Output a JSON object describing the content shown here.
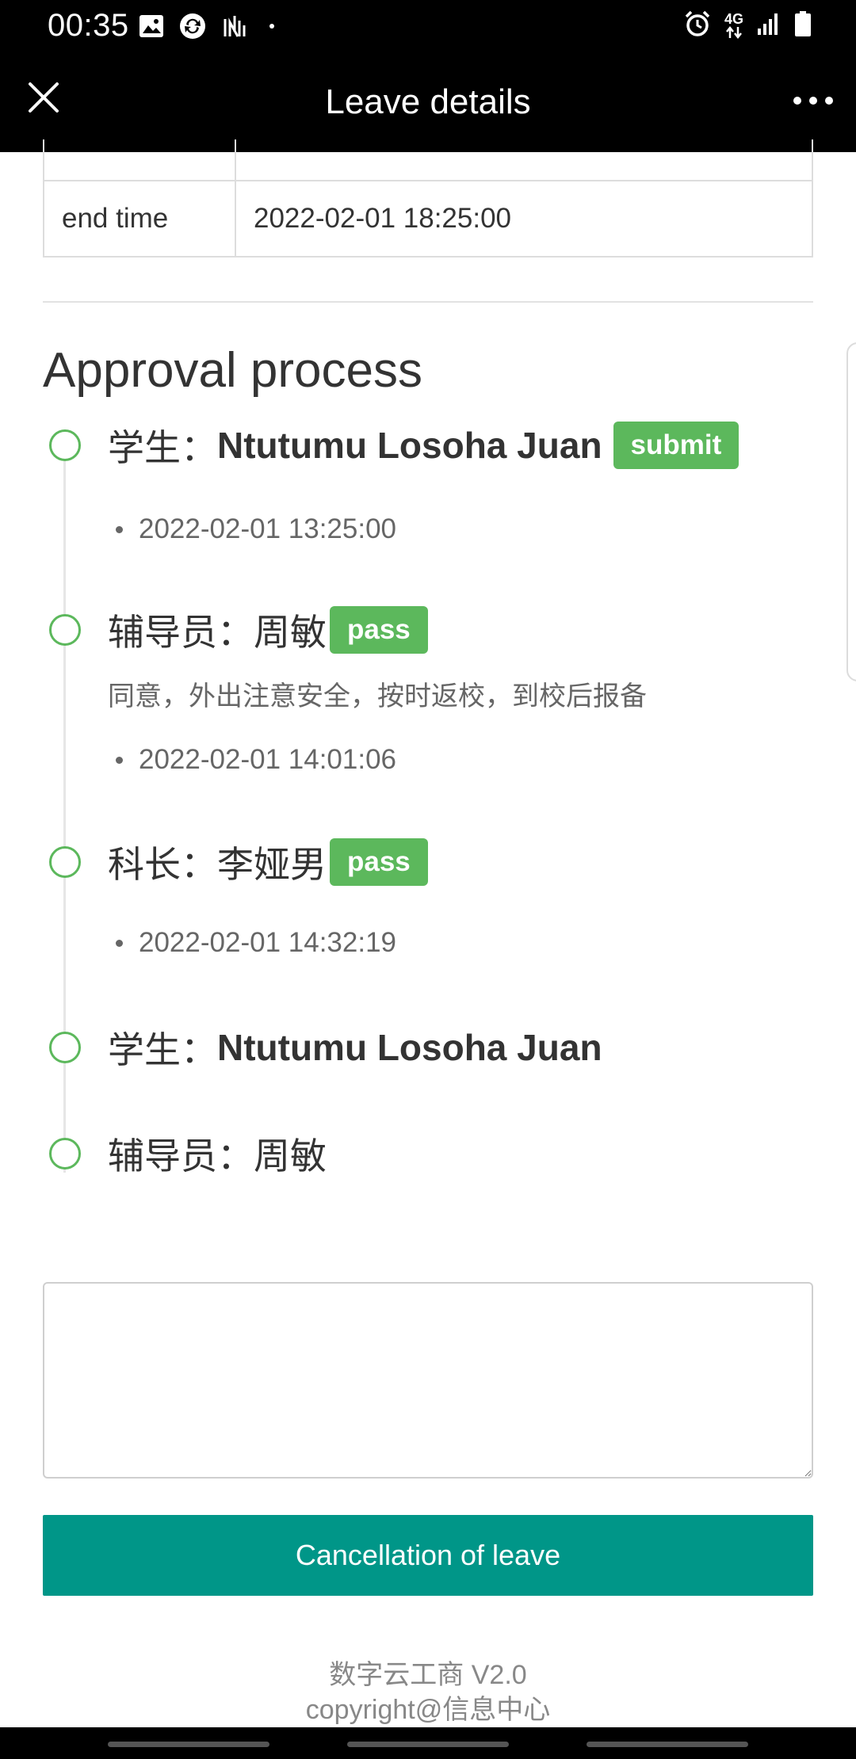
{
  "status_bar": {
    "time": "00:35",
    "network": "4G",
    "icons": [
      "image-icon",
      "sync-icon",
      "nfc-icon",
      "dot-icon",
      "alarm-icon",
      "network-4g-icon",
      "signal-icon",
      "battery-icon"
    ]
  },
  "header": {
    "title": "Leave details",
    "close_icon": "close-icon",
    "more_icon": "more-icon"
  },
  "info_table": {
    "rows": [
      {
        "label": "",
        "value": ""
      },
      {
        "label": "end time",
        "value": "2022-02-01 18:25:00"
      }
    ]
  },
  "approval": {
    "title": "Approval process",
    "steps": [
      {
        "role": "学生：",
        "name": "Ntutumu Losoha Juan",
        "tag": "submit",
        "comment": "",
        "time": "2022-02-01 13:25:00"
      },
      {
        "role": "辅导员：",
        "name": "周敏",
        "tag": "pass",
        "comment": "同意，外出注意安全，按时返校，到校后报备",
        "time": "2022-02-01 14:01:06"
      },
      {
        "role": "科长：",
        "name": "李娅男",
        "tag": "pass",
        "comment": "",
        "time": "2022-02-01 14:32:19"
      },
      {
        "role": "学生：",
        "name": "Ntutumu Losoha Juan",
        "tag": "",
        "comment": "",
        "time": ""
      },
      {
        "role": "辅导员：",
        "name": "周敏",
        "tag": "",
        "comment": "",
        "time": ""
      }
    ]
  },
  "form": {
    "remark_value": "",
    "cancel_button_label": "Cancellation of leave"
  },
  "footer": {
    "line1": "数字云工商 V2.0",
    "line2": "copyright@信息中心"
  },
  "colors": {
    "accent_green": "#5cb85c",
    "button_teal": "#009688",
    "bar_black": "#000000"
  }
}
